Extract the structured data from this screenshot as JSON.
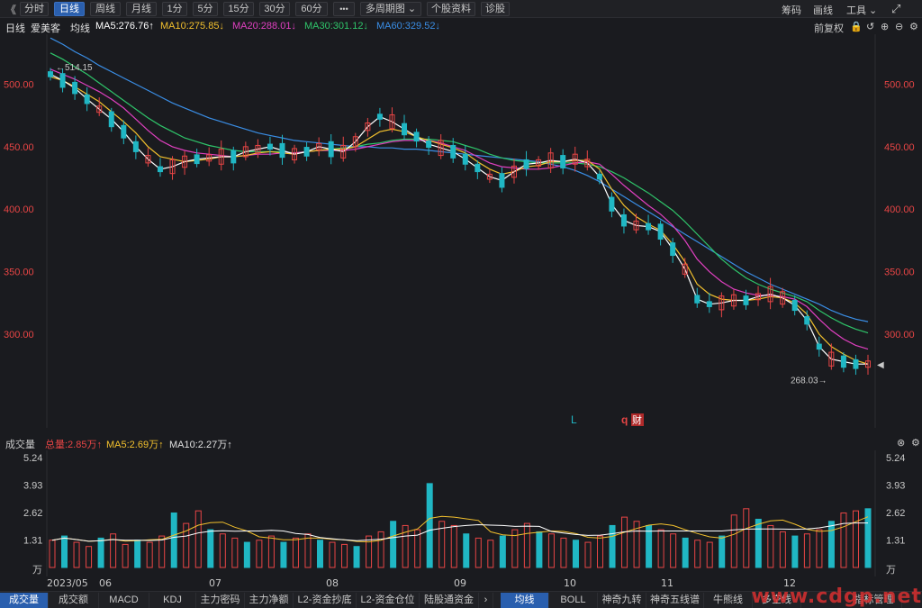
{
  "toolbar": {
    "back_icon": "《",
    "buttons": [
      "分时",
      "日线",
      "周线",
      "月线",
      "1分",
      "5分",
      "15分",
      "30分",
      "60分",
      "•••",
      "多周期图 ⌄",
      "个股资料",
      "诊股"
    ],
    "active": "日线",
    "right": [
      "筹码",
      "画线",
      "工具 ⌄"
    ],
    "expand_icon": "⤢"
  },
  "ma_bar": {
    "period": "日线",
    "stock": "爱美客",
    "mode": "均线",
    "ma5": "MA5:276.76↑",
    "ma10": "MA10:275.85↓",
    "ma20": "MA20:288.01↓",
    "ma30": "MA30:301.12↓",
    "ma60": "MA60:329.52↓",
    "fq": "前复权"
  },
  "colors": {
    "ma5": "#ffffff",
    "ma10": "#f2c02d",
    "ma20": "#e040c0",
    "ma30": "#2fc56a",
    "ma60": "#3a8ee6",
    "up": "#e84545",
    "down": "#20b7c4"
  },
  "price_axis": {
    "ticks": [
      "500.00",
      "450.00",
      "400.00",
      "350.00",
      "300.00"
    ],
    "range": [
      225,
      540
    ]
  },
  "annotations": {
    "high": "514.15",
    "low": "268.03",
    "marker_l": "L",
    "marker_q": "q",
    "marker_cai": "财"
  },
  "volume": {
    "title": "成交量",
    "total": "总量:2.85万↑",
    "ma5": "MA5:2.69万↑",
    "ma10": "MA10:2.27万↑",
    "ticks": [
      "5.24",
      "3.93",
      "2.62",
      "1.31"
    ],
    "unit": "万"
  },
  "x_labels": [
    "2023/05",
    "06",
    "07",
    "08",
    "09",
    "10",
    "11",
    "12"
  ],
  "bottom_tabs": [
    "成交量",
    "成交额",
    "MACD",
    "KDJ",
    "主力密码",
    "主力净额",
    "L2-资金抄底",
    "L2-资金仓位",
    "陆股通资金"
  ],
  "bottom_tabs_right": [
    "均线",
    "BOLL",
    "神奇九转",
    "神奇五线谱",
    "牛熊线",
    "多空线",
    "指标管理"
  ],
  "watermark": "www.cdgp.net",
  "chart_data": {
    "type": "candlestick",
    "ma_series": {
      "ma5": [
        508,
        503,
        497,
        488,
        480,
        472,
        462,
        450,
        440,
        432,
        434,
        438,
        440,
        441,
        442,
        442,
        446,
        448,
        450,
        447,
        444,
        446,
        450,
        448,
        446,
        454,
        466,
        474,
        470,
        464,
        458,
        452,
        449,
        446,
        440,
        433,
        426,
        423,
        430,
        436,
        437,
        439,
        438,
        440,
        437,
        426,
        404,
        391,
        387,
        386,
        382,
        368,
        352,
        328,
        324,
        325,
        327,
        327,
        330,
        332,
        329,
        323,
        311,
        290,
        280,
        278,
        276,
        276
      ],
      "ma10": [
        506,
        503,
        498,
        492,
        486,
        478,
        470,
        461,
        450,
        442,
        440,
        438,
        439,
        440,
        442,
        442,
        443,
        445,
        446,
        445,
        444,
        446,
        447,
        448,
        448,
        450,
        456,
        462,
        464,
        462,
        458,
        455,
        452,
        449,
        445,
        438,
        432,
        428,
        430,
        434,
        435,
        438,
        438,
        439,
        439,
        432,
        416,
        403,
        394,
        388,
        383,
        372,
        358,
        340,
        332,
        328,
        327,
        327,
        328,
        330,
        329,
        325,
        316,
        300,
        290,
        284,
        279,
        276
      ],
      "ma20": [
        512,
        508,
        504,
        499,
        494,
        488,
        481,
        472,
        463,
        455,
        450,
        447,
        445,
        444,
        443,
        442,
        443,
        444,
        444,
        445,
        445,
        446,
        447,
        447,
        447,
        448,
        450,
        452,
        454,
        455,
        455,
        455,
        453,
        450,
        447,
        442,
        437,
        434,
        433,
        432,
        432,
        433,
        435,
        437,
        438,
        436,
        428,
        419,
        411,
        403,
        396,
        387,
        375,
        360,
        350,
        342,
        336,
        333,
        331,
        331,
        330,
        328,
        322,
        312,
        303,
        296,
        291,
        288
      ],
      "ma30": [
        525,
        520,
        514,
        508,
        501,
        494,
        487,
        480,
        473,
        467,
        462,
        457,
        454,
        451,
        449,
        447,
        446,
        446,
        446,
        446,
        445,
        446,
        447,
        448,
        449,
        450,
        452,
        453,
        455,
        456,
        456,
        456,
        455,
        454,
        451,
        448,
        444,
        441,
        439,
        438,
        437,
        437,
        437,
        437,
        436,
        434,
        430,
        425,
        419,
        413,
        406,
        399,
        390,
        380,
        370,
        360,
        352,
        345,
        340,
        336,
        333,
        330,
        326,
        319,
        313,
        308,
        304,
        301
      ],
      "ma60": [
        537,
        532,
        526,
        521,
        515,
        510,
        505,
        500,
        495,
        490,
        485,
        481,
        477,
        473,
        470,
        467,
        464,
        461,
        459,
        457,
        455,
        454,
        453,
        452,
        451,
        450,
        450,
        449,
        449,
        448,
        448,
        447,
        446,
        445,
        444,
        443,
        442,
        441,
        440,
        439,
        438,
        436,
        434,
        431,
        427,
        422,
        416,
        410,
        404,
        398,
        392,
        386,
        380,
        374,
        368,
        362,
        356,
        350,
        345,
        340,
        336,
        332,
        328,
        324,
        319,
        315,
        312,
        310
      ]
    },
    "volume_bars_wan": [
      1.3,
      1.5,
      1.2,
      1.0,
      1.4,
      1.6,
      1.1,
      1.3,
      1.2,
      1.5,
      2.6,
      2.1,
      2.7,
      1.8,
      1.6,
      1.4,
      1.2,
      1.3,
      1.5,
      1.2,
      1.4,
      1.6,
      1.3,
      1.2,
      1.1,
      1.0,
      1.5,
      1.7,
      2.2,
      2.0,
      1.8,
      4.0,
      2.2,
      2.0,
      1.6,
      1.4,
      1.3,
      1.5,
      1.8,
      2.1,
      1.7,
      1.6,
      1.4,
      1.3,
      1.2,
      1.5,
      2.0,
      2.4,
      2.2,
      2.0,
      1.8,
      1.6,
      1.4,
      1.3,
      1.2,
      1.5,
      2.5,
      2.8,
      2.3,
      2.0,
      1.7,
      1.5,
      1.6,
      1.8,
      2.2,
      2.6,
      2.7,
      2.8
    ]
  }
}
